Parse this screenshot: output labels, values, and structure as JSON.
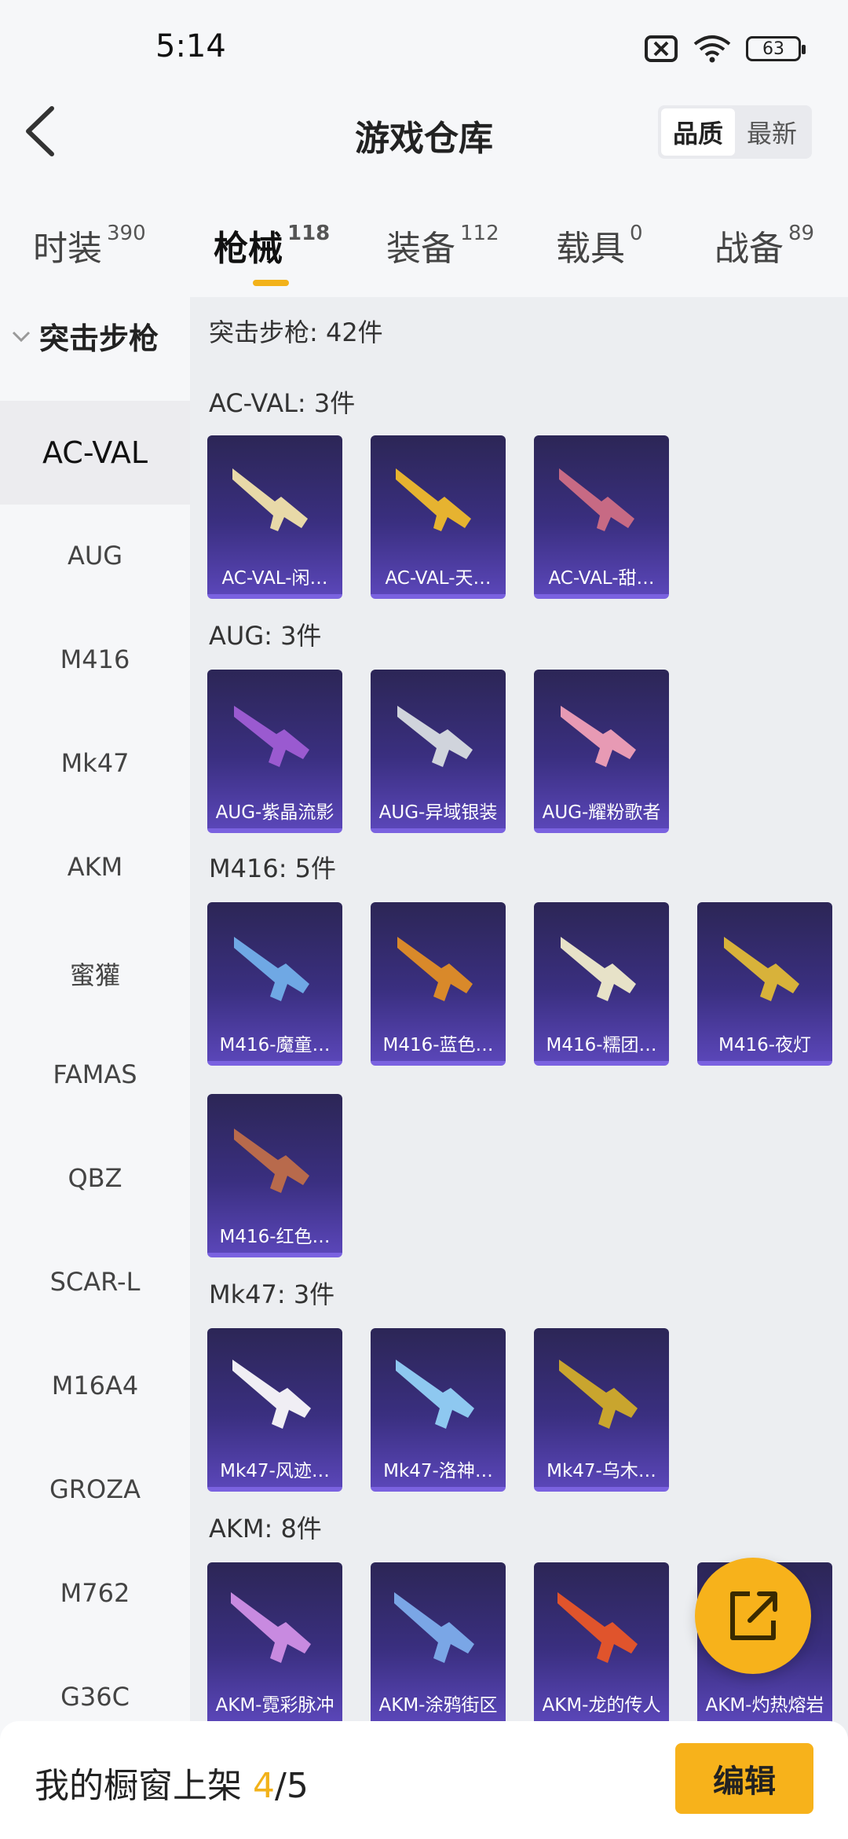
{
  "status": {
    "time": "5:14",
    "battery": "63"
  },
  "header": {
    "title": "游戏仓库",
    "sort_quality": "品质",
    "sort_newest": "最新"
  },
  "tabs": [
    {
      "label": "时装",
      "count": "390"
    },
    {
      "label": "枪械",
      "count": "118"
    },
    {
      "label": "装备",
      "count": "112"
    },
    {
      "label": "载具",
      "count": "0"
    },
    {
      "label": "战备",
      "count": "89"
    }
  ],
  "sidebar": {
    "category": "突击步枪",
    "items": [
      "AC-VAL",
      "AUG",
      "M416",
      "Mk47",
      "AKM",
      "蜜獾",
      "FAMAS",
      "QBZ",
      "SCAR-L",
      "M16A4",
      "GROZA",
      "M762",
      "G36C"
    ]
  },
  "content": {
    "summary": "突击步枪: 42件",
    "groups": [
      {
        "title": "AC-VAL: 3件",
        "items": [
          "AC-VAL-闲…",
          "AC-VAL-天…",
          "AC-VAL-甜…"
        ]
      },
      {
        "title": "AUG: 3件",
        "items": [
          "AUG-紫晶流影",
          "AUG-异域银装",
          "AUG-耀粉歌者"
        ]
      },
      {
        "title": "M416: 5件",
        "items": [
          "M416-魔童…",
          "M416-蓝色…",
          "M416-糯团…",
          "M416-夜灯",
          "M416-红色…"
        ]
      },
      {
        "title": "Mk47: 3件",
        "items": [
          "Mk47-风迹…",
          "Mk47-洛神…",
          "Mk47-乌木…"
        ]
      },
      {
        "title": "AKM: 8件",
        "items": [
          "AKM-霓彩脉冲",
          "AKM-涂鸦街区",
          "AKM-龙的传人",
          "AKM-灼热熔岩"
        ]
      }
    ]
  },
  "bottom": {
    "prefix": "我的橱窗上架 ",
    "current": "4",
    "total": "/5",
    "edit": "编辑"
  },
  "colors": {
    "accent": "#f7b21b",
    "card_bg": "#3a2f80"
  }
}
